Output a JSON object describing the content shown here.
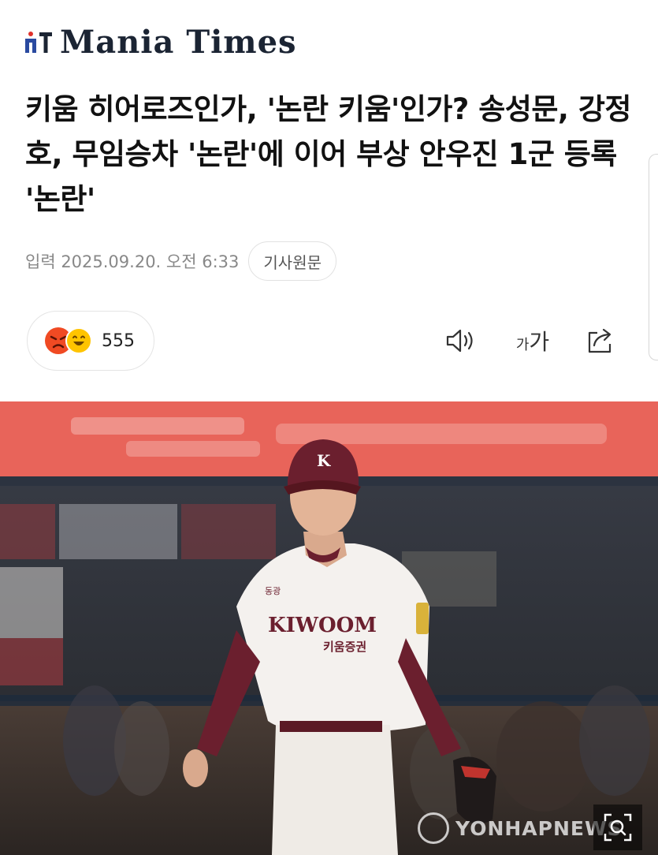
{
  "masthead": {
    "logo_text": "Mania Times",
    "logo_mark": "MT"
  },
  "article": {
    "headline": "키움 히어로즈인가, '논란 키움'인가? 송성문, 강정호, 무임승차 '논란'에 이어 부상 안우진 1군 등록 '논란'",
    "date": "입력 2025.09.20. 오전 6:33",
    "source_button": "기사원문"
  },
  "reactions": {
    "count": "555",
    "emojis": [
      "angry-face-emoji",
      "laughing-face-emoji"
    ]
  },
  "toolbar": {
    "font_size_small": "가",
    "font_size_large": "가",
    "icons": [
      "speaker-icon",
      "font-size-icon",
      "share-icon"
    ]
  },
  "photo": {
    "jersey_text": "KIWOOM",
    "sponsor_text": "키움증권",
    "watermark": "YONHAPNEWS",
    "colors": {
      "sky_banner": "#e8645a",
      "jersey": "#f4f1ee",
      "maroon": "#6b1f2e"
    }
  }
}
